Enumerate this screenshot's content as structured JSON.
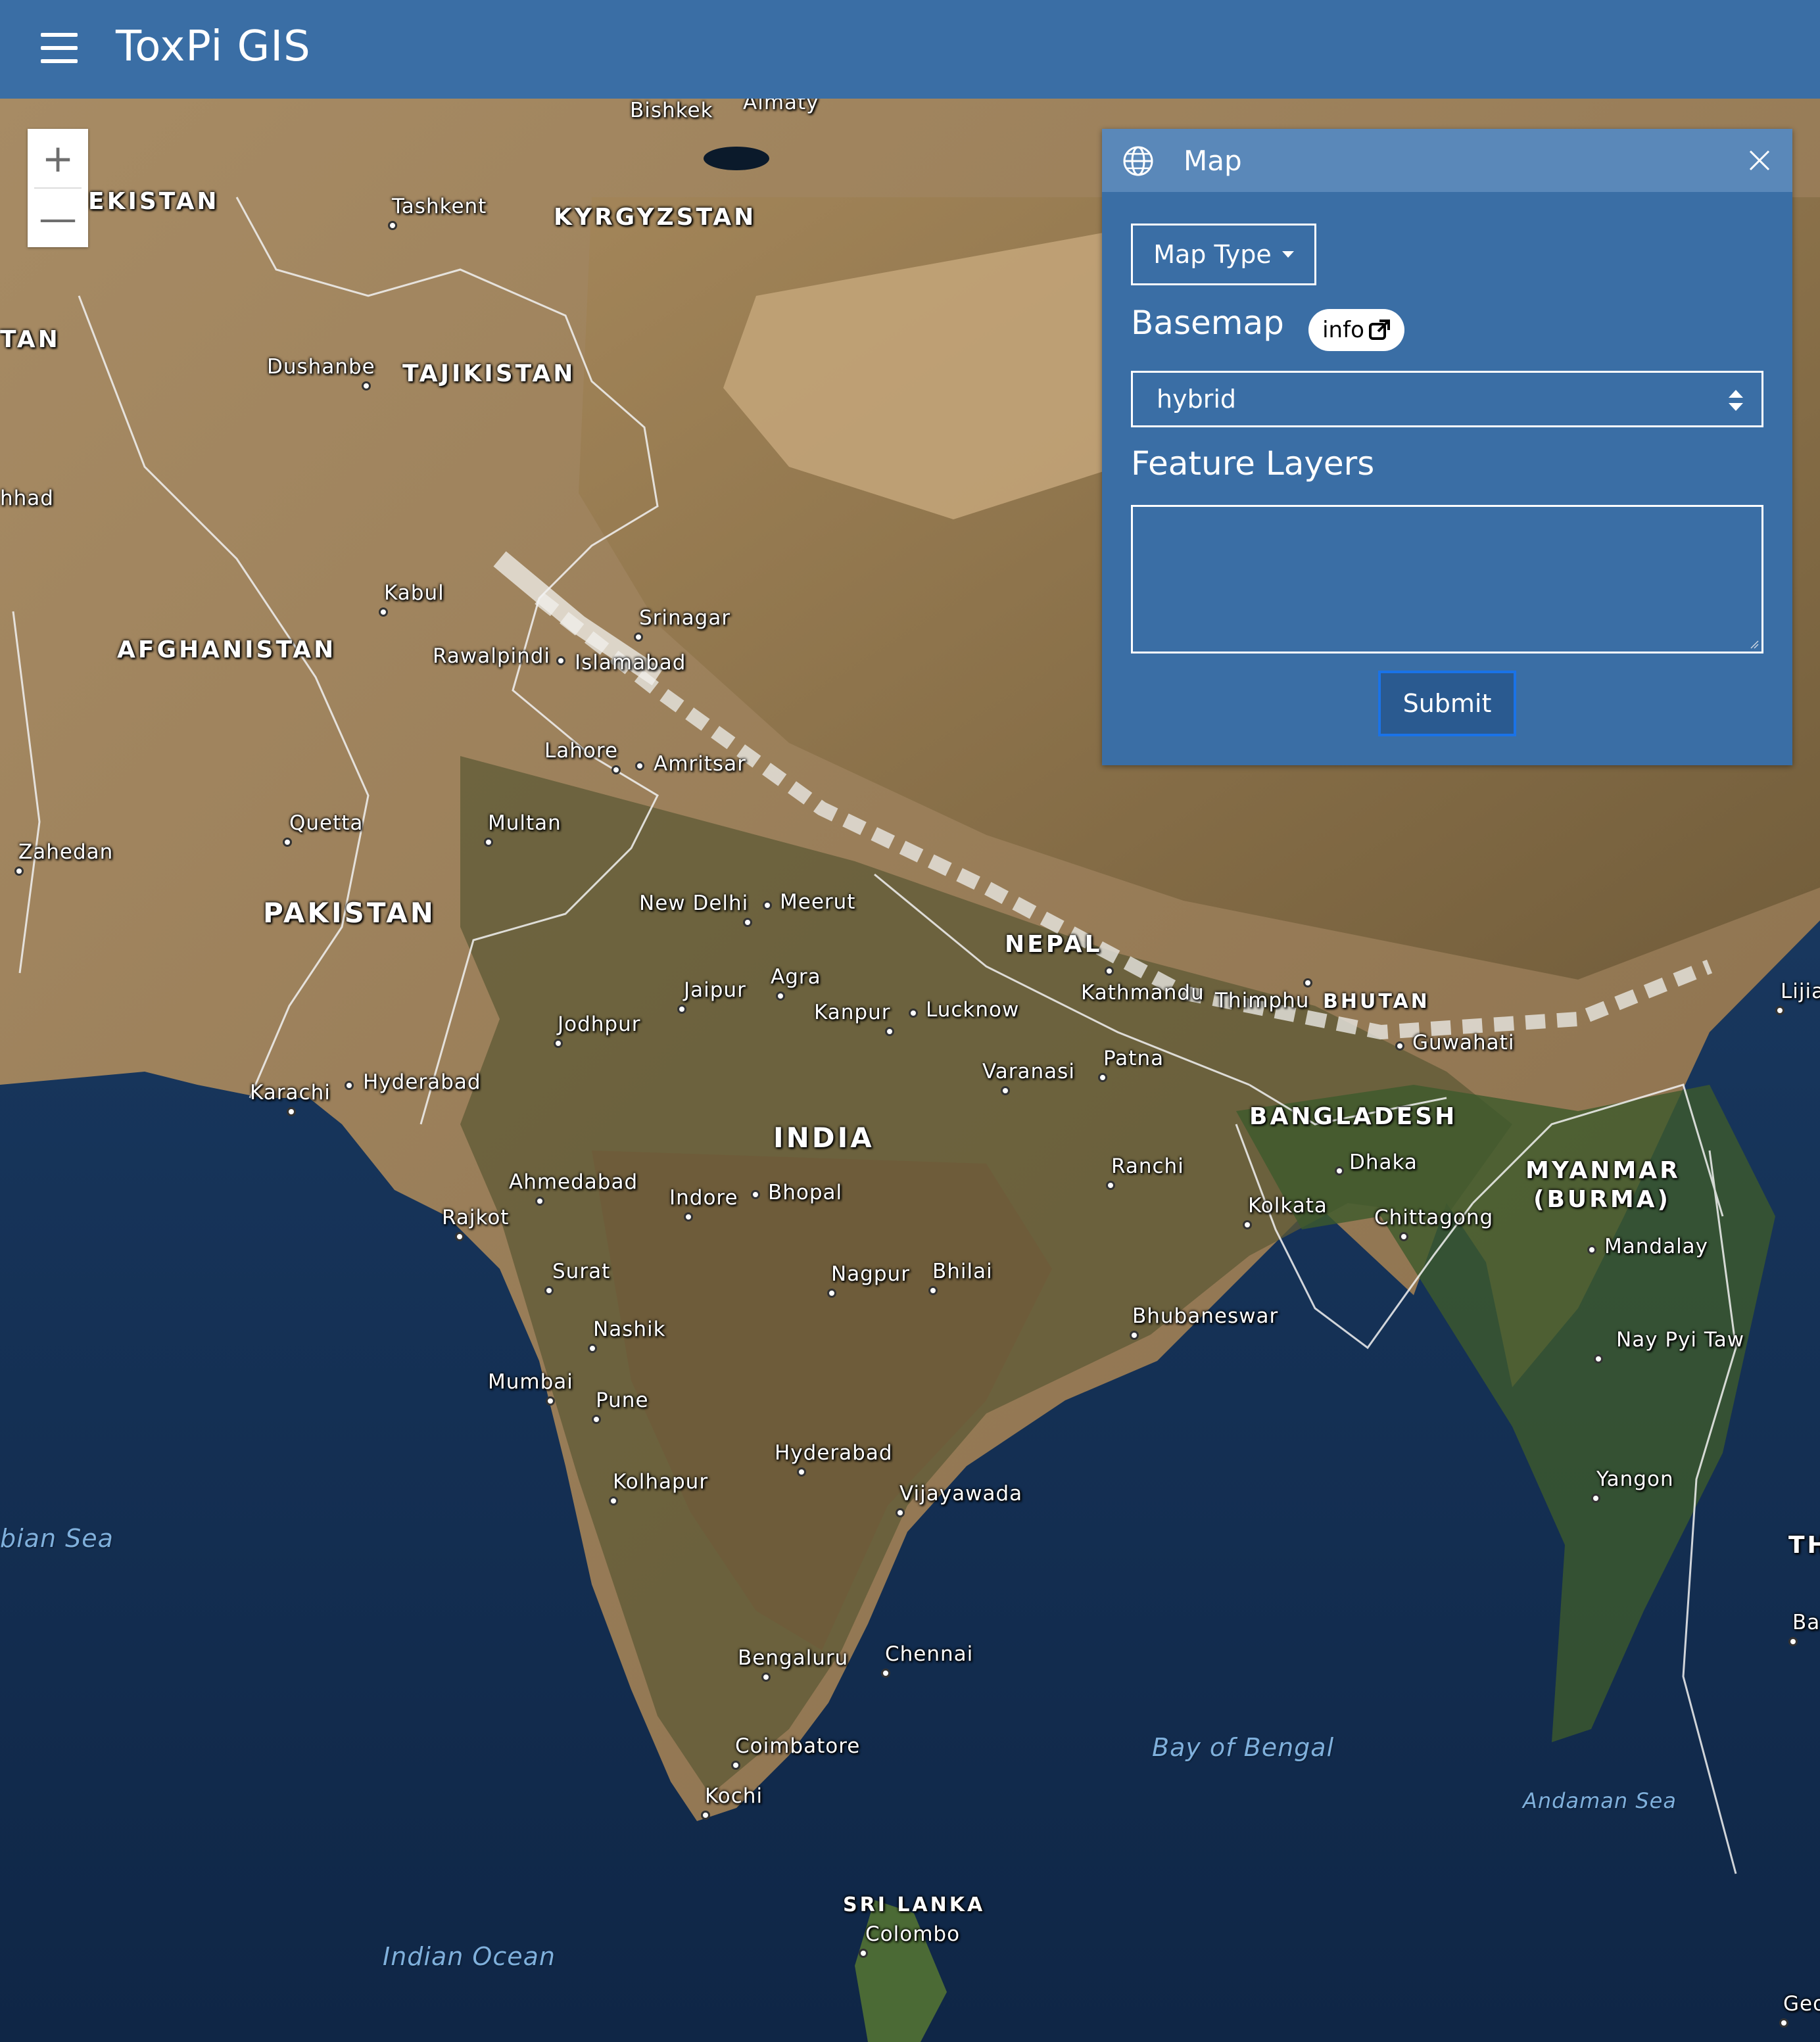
{
  "app": {
    "title": "ToxPi GIS"
  },
  "zoom": {
    "in_symbol": "+",
    "out_symbol": "—"
  },
  "panel": {
    "title": "Map",
    "map_type_label": "Map Type",
    "basemap_label": "Basemap",
    "info_label": "info",
    "basemap_value": "hybrid",
    "feature_layers_label": "Feature Layers",
    "feature_layers_value": "",
    "submit_label": "Submit"
  },
  "map": {
    "countries": [
      "EKISTAN",
      "KYRGYZSTAN",
      "TAN",
      "TAJIKISTAN",
      "AFGHANISTAN",
      "PAKISTAN",
      "NEPAL",
      "BHUTAN",
      "INDIA",
      "BANGLADESH",
      "MYANMAR",
      "(BURMA)",
      "SRI LANKA",
      "TH"
    ],
    "cities": [
      "Bishkek",
      "Almaty",
      "Tashkent",
      "Dushanbe",
      "hhad",
      "Kabul",
      "Srinagar",
      "Rawalpindi",
      "Islamabad",
      "Lahore",
      "Amritsar",
      "Quetta",
      "Multan",
      "Zahedan",
      "New Delhi",
      "Meerut",
      "Jaipur",
      "Agra",
      "Kanpur",
      "Lucknow",
      "Jodhpur",
      "Kathmandu",
      "Thimphu",
      "Guwahati",
      "Lijia",
      "Varanasi",
      "Patna",
      "Karachi",
      "Hyderabad",
      "Ranchi",
      "Dhaka",
      "Ahmedabad",
      "Indore",
      "Bhopal",
      "Rajkot",
      "Kolkata",
      "Chittagong",
      "Mandalay",
      "Surat",
      "Nagpur",
      "Bhilai",
      "Bhubaneswar",
      "Nashik",
      "Nay Pyi Taw",
      "Mumbai",
      "Pune",
      "Hyderabad",
      "Kolhapur",
      "Vijayawada",
      "Yangon",
      "Bengaluru",
      "Chennai",
      "Ba",
      "Coimbatore",
      "Kochi",
      "Colombo",
      "Geo"
    ],
    "water": [
      "bian Sea",
      "Bay of Bengal",
      "Andaman Sea",
      "Indian Ocean"
    ]
  },
  "colors": {
    "header": "#3a6ea5",
    "panel": "#3a6ea5",
    "panel_header": "#5a88b9",
    "submit_border": "#1a73e8"
  }
}
